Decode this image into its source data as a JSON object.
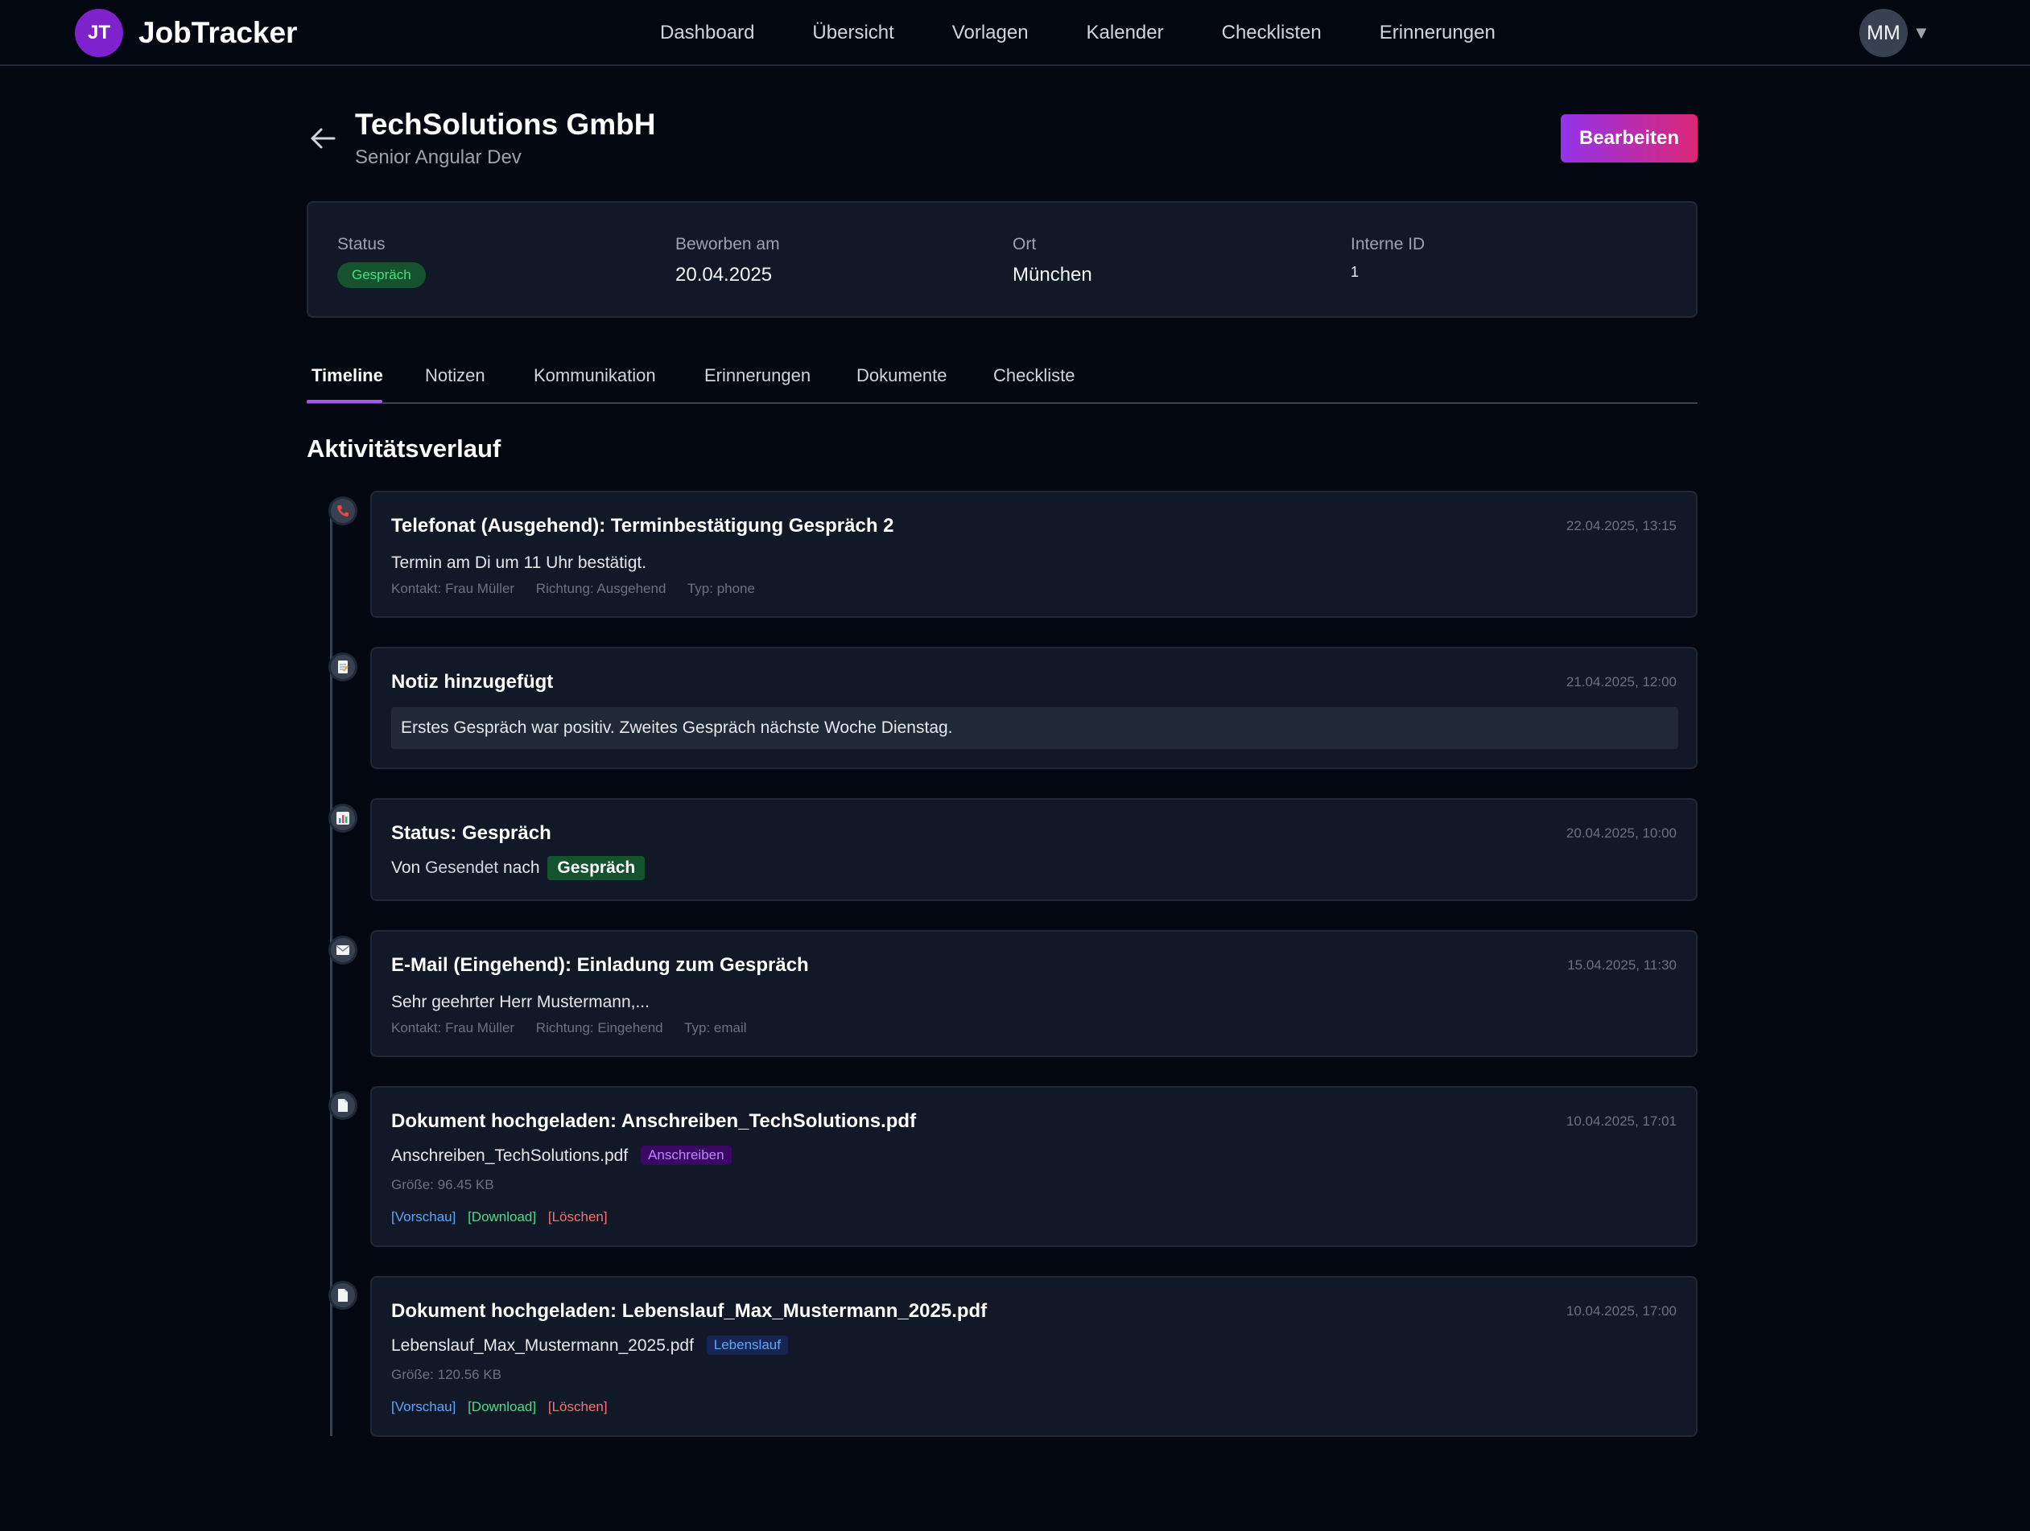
{
  "nav": {
    "logo_initials": "JT",
    "brand": "JobTracker",
    "links": [
      "Dashboard",
      "Übersicht",
      "Vorlagen",
      "Kalender",
      "Checklisten",
      "Erinnerungen"
    ],
    "user_initials": "MM",
    "user_caret": "▼"
  },
  "header": {
    "company": "TechSolutions GmbH",
    "position": "Senior Angular Dev",
    "edit_label": "Bearbeiten"
  },
  "info": {
    "status_label": "Status",
    "status_value": "Gespräch",
    "applied_label": "Beworben am",
    "applied_value": "20.04.2025",
    "location_label": "Ort",
    "location_value": "München",
    "id_label": "Interne ID",
    "id_value": "1"
  },
  "tabs": [
    "Timeline",
    "Notizen",
    "Kommunikation",
    "Erinnerungen",
    "Dokumente",
    "Checkliste"
  ],
  "section_title": "Aktivitätsverlauf",
  "timeline": [
    {
      "icon": "phone-icon",
      "title": "Telefonat (Ausgehend): Terminbestätigung Gespräch 2",
      "time": "22.04.2025, 13:15",
      "body": "Termin am Di um 11 Uhr bestätigt.",
      "meta": [
        "Kontakt: Frau Müller",
        "Richtung: Ausgehend",
        "Typ: phone"
      ]
    },
    {
      "icon": "note-icon",
      "title": "Notiz hinzugefügt",
      "time": "21.04.2025, 12:00",
      "body": "Erstes Gespräch war positiv. Zweites Gespräch nächste Woche Dienstag."
    },
    {
      "icon": "chart-icon",
      "title": "Status: Gespräch",
      "time": "20.04.2025, 10:00",
      "from_prefix": "Von",
      "from_status": "Gesendet",
      "to_prefix": "nach",
      "to_status": "Gespräch"
    },
    {
      "icon": "email-icon",
      "title": "E-Mail (Eingehend): Einladung zum Gespräch",
      "time": "15.04.2025, 11:30",
      "body": "Sehr geehrter Herr Mustermann,...",
      "meta": [
        "Kontakt: Frau Müller",
        "Richtung: Eingehend",
        "Typ: email"
      ]
    },
    {
      "icon": "document-icon",
      "title": "Dokument hochgeladen: Anschreiben_TechSolutions.pdf",
      "time": "10.04.2025, 17:01",
      "filename": "Anschreiben_TechSolutions.pdf",
      "tag": "Anschreiben",
      "size": "Größe: 96.45 KB",
      "actions": [
        "[Vorschau]",
        "[Download]",
        "[Löschen]"
      ]
    },
    {
      "icon": "document-icon",
      "title": "Dokument hochgeladen: Lebenslauf_Max_Mustermann_2025.pdf",
      "time": "10.04.2025, 17:00",
      "filename": "Lebenslauf_Max_Mustermann_2025.pdf",
      "tag": "Lebenslauf",
      "size": "Größe: 120.56 KB",
      "actions": [
        "[Vorschau]",
        "[Download]",
        "[Löschen]"
      ]
    }
  ],
  "colors": {
    "background": "#030712",
    "card": "#111827",
    "accent_purple": "#9333ea",
    "accent_pink": "#db2777",
    "status_green": "#14532d"
  }
}
